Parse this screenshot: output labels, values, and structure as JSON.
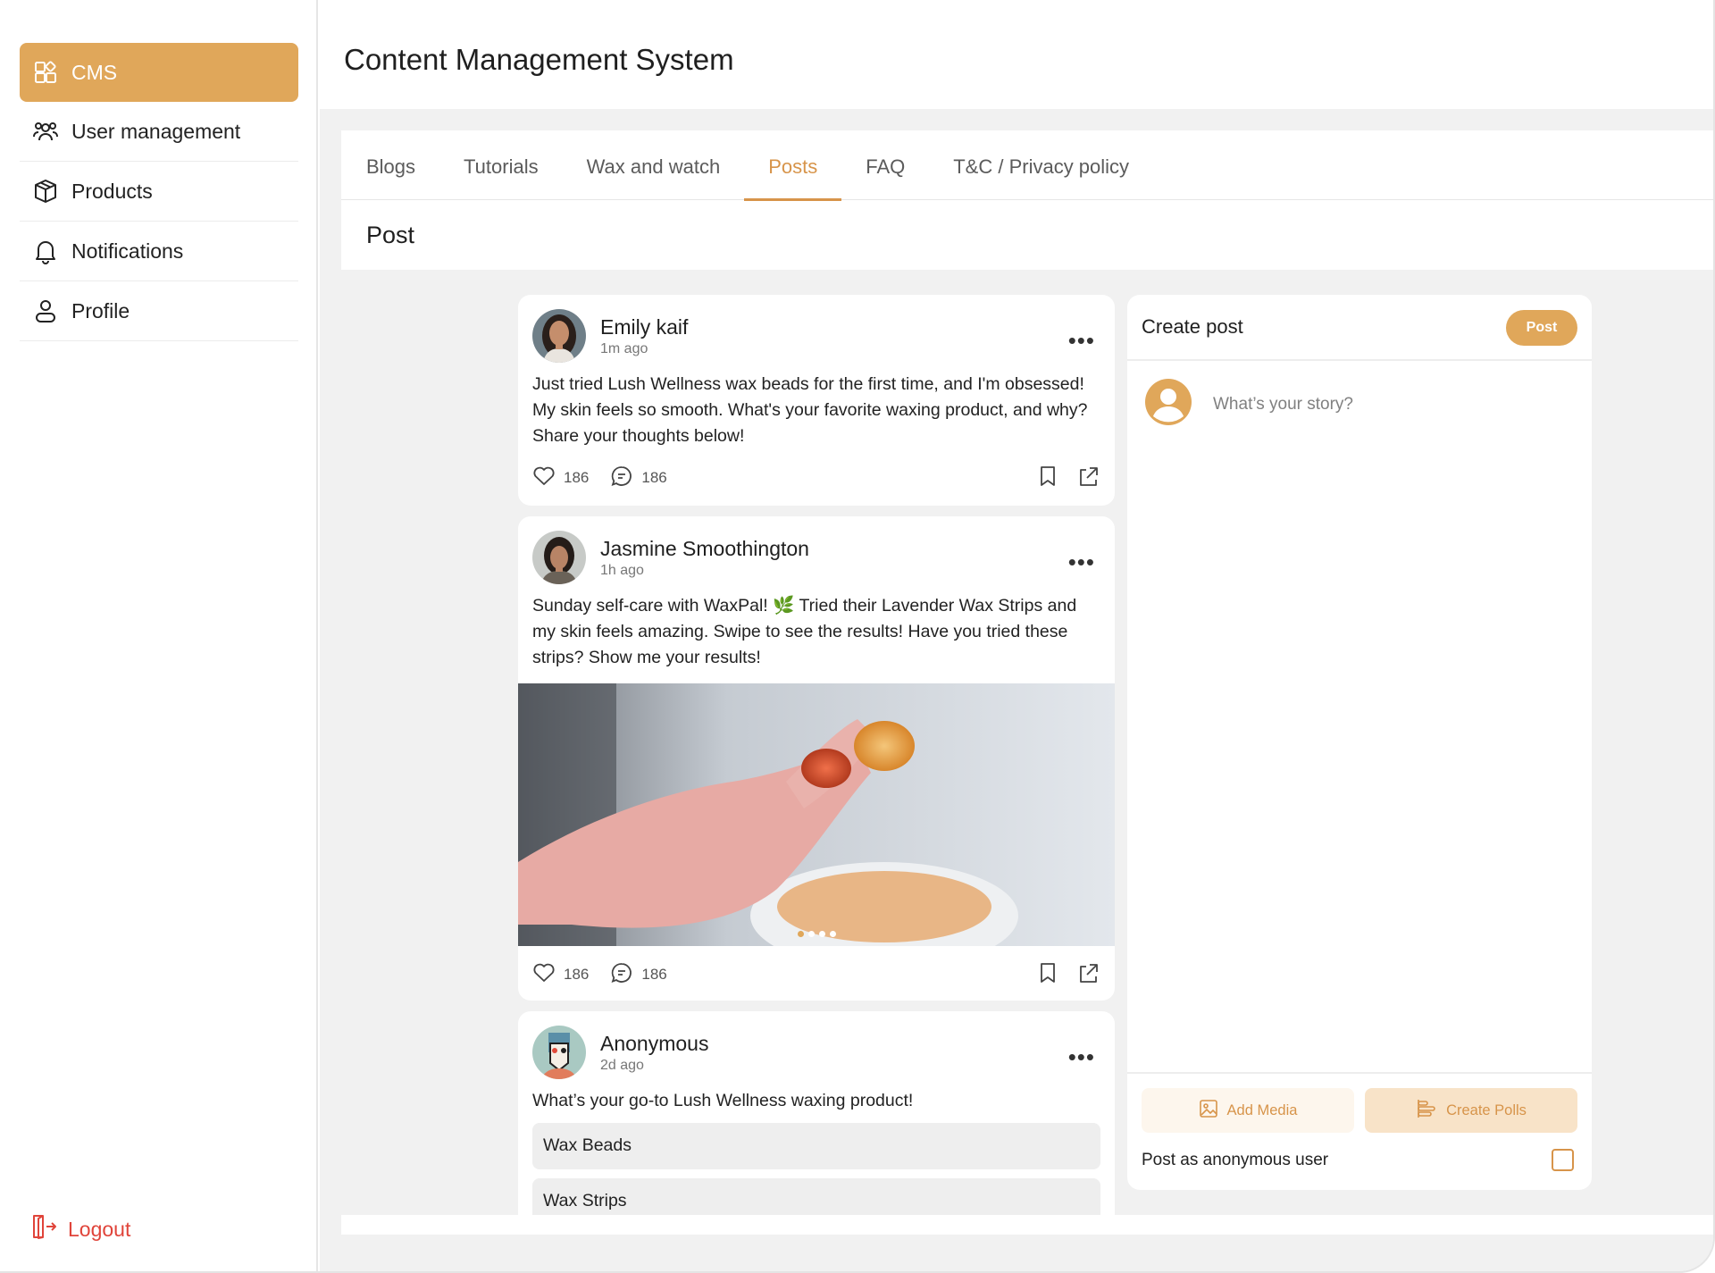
{
  "sidebar": {
    "items": [
      {
        "label": "CMS",
        "icon": "grid-icon",
        "active": true
      },
      {
        "label": "User management",
        "icon": "users-icon",
        "active": false
      },
      {
        "label": "Products",
        "icon": "box-icon",
        "active": false
      },
      {
        "label": "Notifications",
        "icon": "bell-icon",
        "active": false
      },
      {
        "label": "Profile",
        "icon": "user-icon",
        "active": false
      }
    ],
    "logout_label": "Logout"
  },
  "header": {
    "title": "Content Management System"
  },
  "tabs": [
    {
      "label": "Blogs",
      "active": false
    },
    {
      "label": "Tutorials",
      "active": false
    },
    {
      "label": "Wax and watch",
      "active": false
    },
    {
      "label": "Posts",
      "active": true
    },
    {
      "label": "FAQ",
      "active": false
    },
    {
      "label": "T&C / Privacy policy",
      "active": false
    }
  ],
  "section_title": "Post",
  "posts": [
    {
      "author": "Emily kaif",
      "time": "1m ago",
      "text": "Just tried Lush Wellness wax beads for the first time, and I'm obsessed! My skin feels so smooth. What's your favorite waxing product, and why? Share your thoughts below!",
      "likes": "186",
      "comments": "186"
    },
    {
      "author": "Jasmine Smoothington",
      "time": "1h ago",
      "text": "Sunday self-care with WaxPal! 🌿 Tried their Lavender Wax Strips and my skin feels amazing. Swipe to see the results! Have you tried these strips? Show me your results!",
      "likes": "186",
      "comments": "186",
      "carousel_index": 1,
      "carousel_total": 4
    },
    {
      "author": "Anonymous",
      "time": "2d ago",
      "text": "What’s your go-to Lush Wellness waxing product!",
      "poll_options": [
        "Wax Beads",
        "Wax Strips"
      ]
    }
  ],
  "create_post": {
    "title": "Create post",
    "post_button": "Post",
    "placeholder": "What’s your story?",
    "add_media": "Add Media",
    "create_polls": "Create Polls",
    "anonymous_label": "Post as anonymous user",
    "anonymous_checked": false
  },
  "colors": {
    "accent": "#e0a75a",
    "accent_text": "#d7944a",
    "logout": "#e0443a",
    "background": "#f1f1f1"
  }
}
